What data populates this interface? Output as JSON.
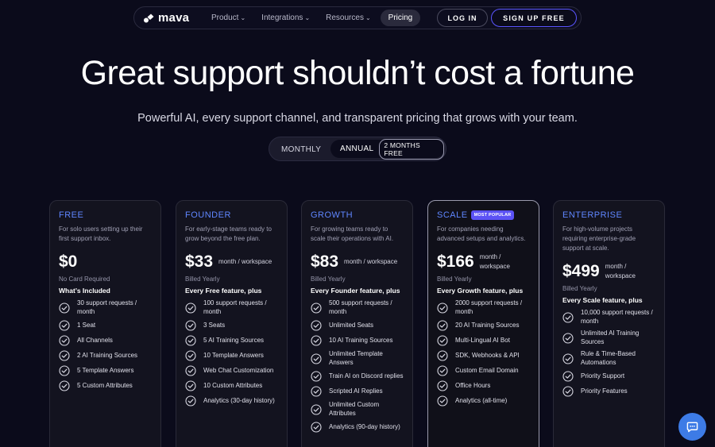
{
  "nav": {
    "logo": "mava",
    "items": [
      {
        "label": "Product",
        "has_dropdown": true
      },
      {
        "label": "Integrations",
        "has_dropdown": true
      },
      {
        "label": "Resources",
        "has_dropdown": true
      }
    ],
    "active": "Pricing",
    "login": "LOG IN",
    "signup": "SIGN UP FREE",
    "chevron": "⌄"
  },
  "hero": {
    "title": "Great support shouldn’t cost a fortune",
    "subtitle": "Powerful AI, every support channel, and transparent pricing that grows with your team."
  },
  "billing_toggle": {
    "monthly": "MONTHLY",
    "annual": "ANNUAL",
    "annual_badge": "2 MONTHS FREE",
    "selected": "ANNUAL"
  },
  "plans": [
    {
      "name": "FREE",
      "description": "For solo users setting up their first support inbox.",
      "price": "$0",
      "unit_line1": "",
      "unit_line2": "",
      "billing": "No Card Required",
      "includes": "What’s Included",
      "features": [
        "30 support requests / month",
        "1 Seat",
        "All Channels",
        "2 AI Training Sources",
        "5 Template Answers",
        "5 Custom Attributes"
      ]
    },
    {
      "name": "FOUNDER",
      "description": "For early-stage teams ready to grow beyond the free plan.",
      "price": "$33",
      "unit_line1": "month / workspace",
      "unit_line2": "",
      "billing": "Billed Yearly",
      "includes": "Every Free feature, plus",
      "features": [
        "100 support requests / month",
        "3 Seats",
        "5 AI Training Sources",
        "10 Template Answers",
        "Web Chat Customization",
        "10 Custom Attributes",
        "Analytics (30-day history)"
      ]
    },
    {
      "name": "GROWTH",
      "description": "For growing teams ready to scale their operations with AI.",
      "price": "$83",
      "unit_line1": "month / workspace",
      "unit_line2": "",
      "billing": "Billed Yearly",
      "includes": "Every Founder feature, plus",
      "features": [
        "500 support requests / month",
        "Unlimited Seats",
        "10 AI Training Sources",
        "Unlimited Template Answers",
        "Train AI on Discord replies",
        "Scripted AI Replies",
        "Unlimited Custom Attributes",
        "Analytics (90-day history)"
      ]
    },
    {
      "name": "SCALE",
      "badge": "MOST POPULAR",
      "description": "For companies needing advanced setups and analytics.",
      "price": "$166",
      "unit_line1": "month /",
      "unit_line2": "workspace",
      "billing": "Billed Yearly",
      "includes": "Every Growth feature, plus",
      "features": [
        "2000 support requests / month",
        "20 AI Training Sources",
        "Multi-Lingual AI Bot",
        "SDK, Webhooks & API",
        "Custom Email Domain",
        "Office Hours",
        "Analytics (all-time)"
      ]
    },
    {
      "name": "ENTERPRISE",
      "description": "For high-volume projects requiring enterprise-grade support at scale.",
      "price": "$499",
      "unit_line1": "month /",
      "unit_line2": "workspace",
      "billing": "Billed Yearly",
      "includes": "Every Scale feature, plus",
      "features": [
        "10,000 support requests / month",
        "Unlimited AI Training Sources",
        "Rule & Time-Based Automations",
        "Priority Support",
        "Priority Features"
      ]
    }
  ],
  "colors": {
    "background": "#0b0b1b",
    "accent_blue": "#5f86ff",
    "signup_border": "#5a55ff",
    "popular_badge": "#5b52f5",
    "chat_button": "#3d7be6"
  },
  "icons": {
    "logo": "mava-logo-icon",
    "feature": "check-circle-icon",
    "chat": "chat-bubble-icon"
  }
}
